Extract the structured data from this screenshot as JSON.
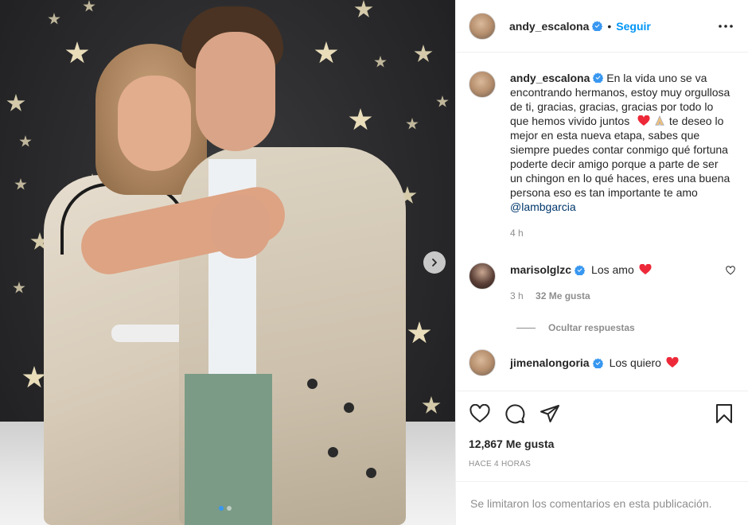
{
  "post": {
    "author": "andy_escalona",
    "follow_label": "Seguir",
    "separator": "•",
    "caption": "En la vida uno se va encontrando hermanos, estoy muy orgullosa de ti, gracias, gracias, gracias por todo lo que hemos vivido juntos",
    "caption_part2": "te deseo lo mejor en esta nueva etapa, sabes que siempre puedes contar conmigo qué fortuna poderte decir amigo porque a parte de ser un chingon en lo qué haces, eres una buena persona eso es tan importante te amo",
    "mention": "@lambgarcia",
    "caption_time": "4 h",
    "likes": "12,867 Me gusta",
    "posted_ago": "HACE 4 HORAS",
    "comments_limited": "Se limitaron los comentarios en esta publicación.",
    "carousel": {
      "slides": 2,
      "active_slide": 1
    }
  },
  "comments": [
    {
      "user": "marisolglzc",
      "text": "Los amo",
      "time": "3 h",
      "likes": "32 Me gusta"
    },
    {
      "user": "jimenalongoria",
      "text": "Los quiero"
    }
  ],
  "hide_replies_label": "Ocultar respuestas",
  "icons": {
    "verified": "verified-badge-icon",
    "more": "more-options-icon",
    "like": "heart-icon",
    "comment": "comment-icon",
    "share": "share-icon",
    "save": "bookmark-icon",
    "next": "chevron-right-icon"
  },
  "colors": {
    "accent": "#0095f6",
    "heart_emoji": "#ed2939",
    "muted": "#8e8e8e",
    "text": "#262626"
  }
}
